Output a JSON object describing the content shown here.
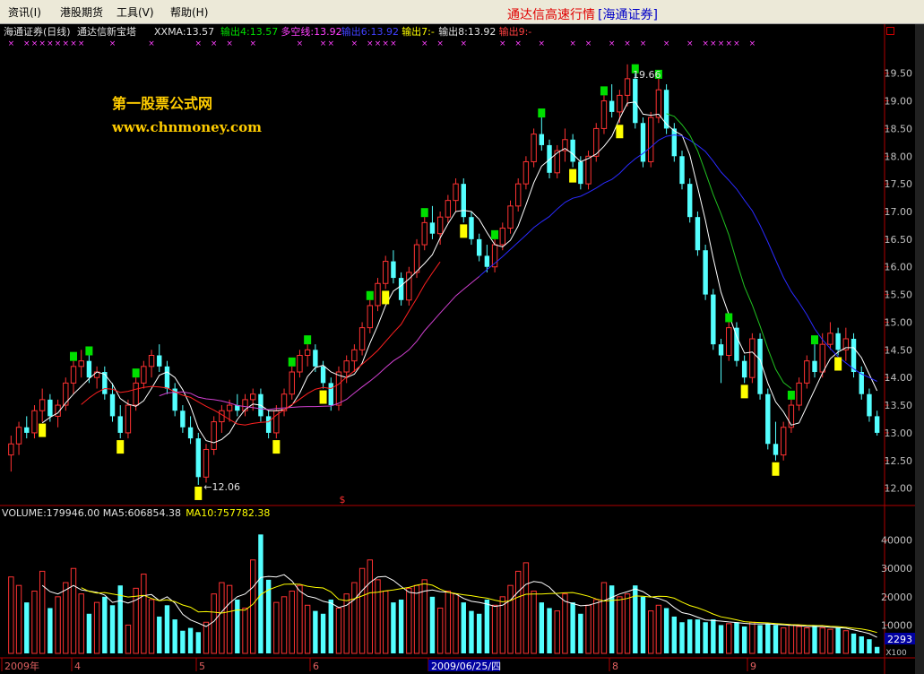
{
  "menu": [
    "资讯(I)",
    "港股期货",
    "工具(V)",
    "帮助(H)"
  ],
  "app_title": "通达信高速行情",
  "broker": "[海通证券]",
  "price_panel": {
    "header_stock": "海通证券(日线)",
    "header_indicator": "通达信新宝塔",
    "header_values": [
      {
        "text": "XXMA:13.57",
        "color": "#e0e0e0"
      },
      {
        "text": "输出4:13.57",
        "color": "#00e000"
      },
      {
        "text": "多空线:13.92",
        "color": "#ff40ff"
      },
      {
        "text": "输出6:13.92",
        "color": "#4040ff"
      },
      {
        "text": "输出7:-",
        "color": "#ffff00"
      },
      {
        "text": "输出8:13.92",
        "color": "#e0e0e0"
      },
      {
        "text": "输出9:-",
        "color": "#ff4040"
      }
    ],
    "watermark_title": "第一股票公式网",
    "watermark_url": "www.chnmoney.com",
    "high_label": "19.66",
    "low_label": "12.06",
    "dollar_mark": "$",
    "y_ticks": [
      "19.50",
      "19.00",
      "18.50",
      "18.00",
      "17.50",
      "17.00",
      "16.50",
      "16.00",
      "15.50",
      "15.00",
      "14.50",
      "14.00",
      "13.50",
      "13.00",
      "12.50",
      "12.00"
    ]
  },
  "volume_panel": {
    "header": [
      {
        "text": "VOLUME:179946.00",
        "color": "#e0e0e0"
      },
      {
        "text": "MA5:606854.38",
        "color": "#e0e0e0"
      },
      {
        "text": "MA10:757782.38",
        "color": "#ffff00"
      }
    ],
    "y_ticks": [
      "40000",
      "30000",
      "20000",
      "10000"
    ],
    "unit_label": "X100",
    "current_value_box": "2293"
  },
  "x_axis": {
    "labels": [
      "2009年",
      "4",
      "5",
      "6",
      "2009/06/25/四",
      "8",
      "9"
    ]
  },
  "colors": {
    "up": "#ff3232",
    "down": "#54ffff",
    "axis": "#b00000",
    "tick_text": "#c0c0c0",
    "watermark": "#ffcc00",
    "green_marker": "#00e000",
    "yellow_marker": "#ffff00"
  },
  "chart_data": {
    "type": "candlestick",
    "title": "海通证券(日线)",
    "ylim": [
      11.8,
      19.9
    ],
    "volume_ylim": [
      0,
      44000
    ],
    "ohlc": [
      [
        12.6,
        12.95,
        12.3,
        12.8
      ],
      [
        12.8,
        13.2,
        12.6,
        13.1
      ],
      [
        13.1,
        13.3,
        12.9,
        13.0
      ],
      [
        13.0,
        13.5,
        12.9,
        13.4
      ],
      [
        13.4,
        13.8,
        13.2,
        13.6
      ],
      [
        13.6,
        13.7,
        13.2,
        13.3
      ],
      [
        13.3,
        13.6,
        13.1,
        13.5
      ],
      [
        13.5,
        14.0,
        13.4,
        13.9
      ],
      [
        13.9,
        14.3,
        13.7,
        14.2
      ],
      [
        14.2,
        14.5,
        14.0,
        14.3
      ],
      [
        14.3,
        14.4,
        13.9,
        14.0
      ],
      [
        14.0,
        14.2,
        13.8,
        14.1
      ],
      [
        14.1,
        14.2,
        13.6,
        13.7
      ],
      [
        13.7,
        13.9,
        13.2,
        13.3
      ],
      [
        13.3,
        13.5,
        12.9,
        13.0
      ],
      [
        13.0,
        13.6,
        12.9,
        13.5
      ],
      [
        13.5,
        14.0,
        13.4,
        13.9
      ],
      [
        13.9,
        14.3,
        13.8,
        14.2
      ],
      [
        14.2,
        14.5,
        14.0,
        14.4
      ],
      [
        14.4,
        14.6,
        14.1,
        14.2
      ],
      [
        14.2,
        14.3,
        13.7,
        13.8
      ],
      [
        13.8,
        13.9,
        13.3,
        13.4
      ],
      [
        13.4,
        13.5,
        13.0,
        13.1
      ],
      [
        13.1,
        13.3,
        12.8,
        12.9
      ],
      [
        12.9,
        13.0,
        12.06,
        12.2
      ],
      [
        12.2,
        12.8,
        12.1,
        12.7
      ],
      [
        12.7,
        13.3,
        12.6,
        13.2
      ],
      [
        13.2,
        13.5,
        13.0,
        13.4
      ],
      [
        13.4,
        13.6,
        13.2,
        13.5
      ],
      [
        13.5,
        13.7,
        13.3,
        13.4
      ],
      [
        13.4,
        13.7,
        13.3,
        13.6
      ],
      [
        13.6,
        13.8,
        13.4,
        13.7
      ],
      [
        13.7,
        13.8,
        13.2,
        13.3
      ],
      [
        13.3,
        13.4,
        12.9,
        13.0
      ],
      [
        13.0,
        13.5,
        12.9,
        13.4
      ],
      [
        13.4,
        13.8,
        13.3,
        13.7
      ],
      [
        13.7,
        14.2,
        13.6,
        14.1
      ],
      [
        14.1,
        14.5,
        14.0,
        14.4
      ],
      [
        14.4,
        14.6,
        14.2,
        14.5
      ],
      [
        14.5,
        14.6,
        14.1,
        14.2
      ],
      [
        14.2,
        14.3,
        13.8,
        13.9
      ],
      [
        13.9,
        14.0,
        13.4,
        13.5
      ],
      [
        13.5,
        14.2,
        13.4,
        14.1
      ],
      [
        14.1,
        14.4,
        13.9,
        14.3
      ],
      [
        14.3,
        14.6,
        14.1,
        14.5
      ],
      [
        14.5,
        15.0,
        14.4,
        14.9
      ],
      [
        14.9,
        15.4,
        14.8,
        15.3
      ],
      [
        15.3,
        15.8,
        15.2,
        15.7
      ],
      [
        15.7,
        16.2,
        15.6,
        16.1
      ],
      [
        16.1,
        16.3,
        15.7,
        15.8
      ],
      [
        15.8,
        15.9,
        15.3,
        15.4
      ],
      [
        15.4,
        16.0,
        15.3,
        15.9
      ],
      [
        15.9,
        16.5,
        15.8,
        16.4
      ],
      [
        16.4,
        16.9,
        16.3,
        16.8
      ],
      [
        16.8,
        17.1,
        16.5,
        16.6
      ],
      [
        16.6,
        17.0,
        16.4,
        16.9
      ],
      [
        16.9,
        17.3,
        16.8,
        17.2
      ],
      [
        17.2,
        17.6,
        17.0,
        17.5
      ],
      [
        17.5,
        17.6,
        16.8,
        16.9
      ],
      [
        16.9,
        17.0,
        16.4,
        16.5
      ],
      [
        16.5,
        16.6,
        16.1,
        16.2
      ],
      [
        16.2,
        16.4,
        15.9,
        16.0
      ],
      [
        16.0,
        16.5,
        15.9,
        16.4
      ],
      [
        16.4,
        16.8,
        16.3,
        16.7
      ],
      [
        16.7,
        17.2,
        16.6,
        17.1
      ],
      [
        17.1,
        17.6,
        17.0,
        17.5
      ],
      [
        17.5,
        18.0,
        17.4,
        17.9
      ],
      [
        17.9,
        18.5,
        17.8,
        18.4
      ],
      [
        18.4,
        18.7,
        18.1,
        18.2
      ],
      [
        18.2,
        18.3,
        17.6,
        17.7
      ],
      [
        17.7,
        18.2,
        17.6,
        18.1
      ],
      [
        18.1,
        18.5,
        17.9,
        18.3
      ],
      [
        18.3,
        18.4,
        17.8,
        17.9
      ],
      [
        17.9,
        18.0,
        17.4,
        17.5
      ],
      [
        17.5,
        18.1,
        17.4,
        18.0
      ],
      [
        18.0,
        18.6,
        17.9,
        18.5
      ],
      [
        18.5,
        19.1,
        18.4,
        19.0
      ],
      [
        19.0,
        19.3,
        18.7,
        18.8
      ],
      [
        18.8,
        19.2,
        18.6,
        19.1
      ],
      [
        19.1,
        19.66,
        18.9,
        19.4
      ],
      [
        19.4,
        19.5,
        18.5,
        18.6
      ],
      [
        18.6,
        18.7,
        17.8,
        17.9
      ],
      [
        17.9,
        18.8,
        17.8,
        18.7
      ],
      [
        18.7,
        19.4,
        18.6,
        19.2
      ],
      [
        19.2,
        19.3,
        18.4,
        18.5
      ],
      [
        18.5,
        18.6,
        17.9,
        18.0
      ],
      [
        18.0,
        18.1,
        17.4,
        17.5
      ],
      [
        17.5,
        17.6,
        16.8,
        16.9
      ],
      [
        16.9,
        17.0,
        16.2,
        16.3
      ],
      [
        16.3,
        16.4,
        15.4,
        15.5
      ],
      [
        15.5,
        15.6,
        14.5,
        14.6
      ],
      [
        14.6,
        14.7,
        13.9,
        14.4
      ],
      [
        14.4,
        15.0,
        14.3,
        14.9
      ],
      [
        14.9,
        15.0,
        14.2,
        14.3
      ],
      [
        14.3,
        14.4,
        13.9,
        14.0
      ],
      [
        14.0,
        14.8,
        13.9,
        14.7
      ],
      [
        14.7,
        14.8,
        13.6,
        13.7
      ],
      [
        13.7,
        13.8,
        12.7,
        12.8
      ],
      [
        12.8,
        13.2,
        12.5,
        12.6
      ],
      [
        12.6,
        13.2,
        12.5,
        13.1
      ],
      [
        13.1,
        13.6,
        13.0,
        13.5
      ],
      [
        13.5,
        14.0,
        13.4,
        13.9
      ],
      [
        13.9,
        14.4,
        13.8,
        14.3
      ],
      [
        14.3,
        14.6,
        14.0,
        14.1
      ],
      [
        14.1,
        14.8,
        14.0,
        14.6
      ],
      [
        14.6,
        15.0,
        14.5,
        14.8
      ],
      [
        14.8,
        14.9,
        14.4,
        14.5
      ],
      [
        14.5,
        14.9,
        14.3,
        14.7
      ],
      [
        14.7,
        14.8,
        14.0,
        14.1
      ],
      [
        14.1,
        14.2,
        13.6,
        13.7
      ],
      [
        13.7,
        13.8,
        13.2,
        13.3
      ],
      [
        13.3,
        13.4,
        12.95,
        13.0
      ]
    ],
    "volume": [
      27000,
      24000,
      18000,
      22000,
      29000,
      16000,
      20000,
      25000,
      30000,
      21000,
      14000,
      18000,
      20000,
      17000,
      24000,
      10000,
      23000,
      28000,
      19000,
      13000,
      17000,
      12000,
      8000,
      9000,
      7500,
      11000,
      21000,
      25000,
      24000,
      19000,
      16000,
      33000,
      42000,
      26000,
      18000,
      20000,
      22000,
      24000,
      17000,
      15000,
      14000,
      19000,
      16000,
      21000,
      25000,
      30000,
      33000,
      26000,
      22000,
      18000,
      19000,
      23000,
      24000,
      26000,
      20000,
      16000,
      22000,
      21000,
      18000,
      15000,
      14000,
      19000,
      17000,
      20000,
      24000,
      29000,
      32000,
      22000,
      18000,
      16000,
      15000,
      21000,
      18000,
      14000,
      17000,
      19000,
      25000,
      24000,
      20000,
      21000,
      24000,
      20000,
      15000,
      17000,
      16000,
      13000,
      11000,
      12000,
      12000,
      11000,
      12000,
      10000,
      10500,
      11000,
      9500,
      11000,
      10000,
      10500,
      10000,
      9000,
      10000,
      9500,
      9000,
      10000,
      9000,
      8500,
      9000,
      8000,
      7000,
      6000,
      5000,
      2293
    ]
  }
}
